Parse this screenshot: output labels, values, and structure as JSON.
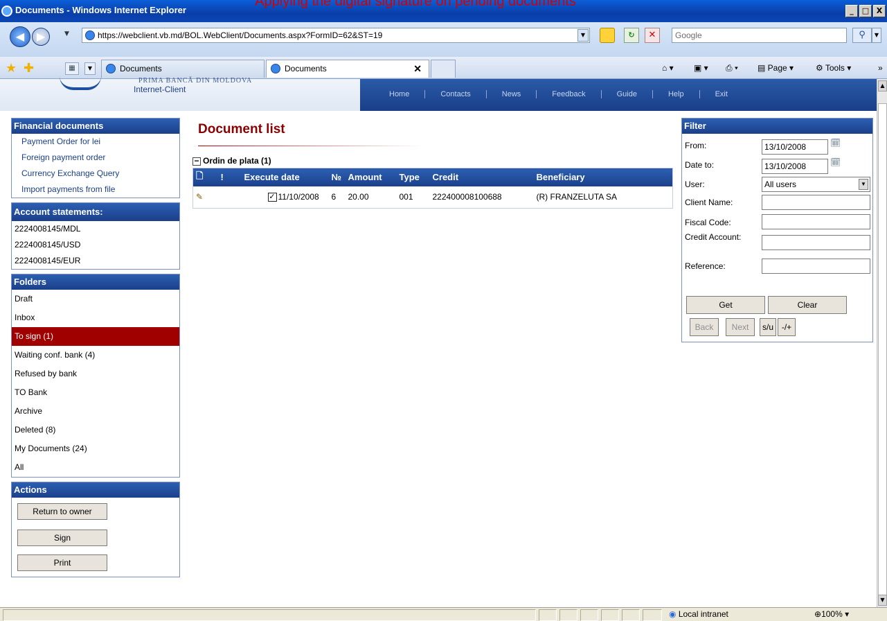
{
  "caption": "Applying the digital signature on pending documents",
  "window": {
    "title": "Documents - Windows Internet Explorer",
    "btn_min": "_",
    "btn_max": "□",
    "btn_close": "X"
  },
  "address": {
    "url": "https://webclient.vb.md/BOL.WebClient/Documents.aspx?FormID=62&ST=19",
    "search_text": "Google"
  },
  "tabs": [
    {
      "label": "Documents"
    },
    {
      "label": "Documents"
    }
  ],
  "commands": {
    "page": "Page",
    "tools": "Tools"
  },
  "site": {
    "logo_line1": "PRIMA BANCĂ DIN MOLDOVA",
    "logo_line2": "Internet-Client",
    "nav": [
      "Home",
      "Contacts",
      "News",
      "Feedback",
      "Guide",
      "Help",
      "Exit"
    ]
  },
  "financial_documents": {
    "title": "Financial documents",
    "items": [
      "Payment Order for lei",
      "Foreign payment order",
      "Currency Exchange Query",
      "Import payments from file"
    ]
  },
  "account_statements": {
    "title": "Account statements:",
    "items": [
      "2224008145/MDL",
      "2224008145/USD",
      "2224008145/EUR"
    ]
  },
  "folders": {
    "title": "Folders",
    "items": [
      "Draft",
      "Inbox",
      "To sign (1)",
      "Waiting conf. bank (4)",
      "Refused by bank",
      "TO Bank",
      "Archive",
      "Deleted (8)",
      "My Documents (24)",
      "All"
    ],
    "active_index": 2
  },
  "actions": {
    "title": "Actions",
    "return_to_owner": "Return to owner",
    "sign": "Sign",
    "print": "Print"
  },
  "document_list": {
    "title": "Document list",
    "group_label": "Ordin de plata (1)",
    "columns": [
      "",
      "!",
      "Execute date",
      "№",
      "Amount",
      "Type",
      "Credit",
      "Beneficiary"
    ],
    "rows": [
      {
        "checked": true,
        "execute_date": "11/10/2008",
        "number": "6",
        "amount": "20.00",
        "type": "001",
        "credit": "222400008100688",
        "beneficiary": "(R) FRANZELUTA SA"
      }
    ]
  },
  "filter": {
    "title": "Filter",
    "from_label": "From:",
    "from_value": "13/10/2008",
    "to_label": "Date to:",
    "to_value": "13/10/2008",
    "user_label": "User:",
    "user_value": "All users",
    "client_name_label": "Client Name:",
    "fiscal_code_label": "Fiscal Code:",
    "credit_account_label": "Credit Account:",
    "reference_label": "Reference:",
    "get_label": "Get",
    "clear_label": "Clear",
    "back_label": "Back",
    "next_label": "Next",
    "su_label": "s/u",
    "pm_label": "-/+"
  },
  "status": {
    "zone": "Local intranet",
    "zoom": "100%"
  }
}
